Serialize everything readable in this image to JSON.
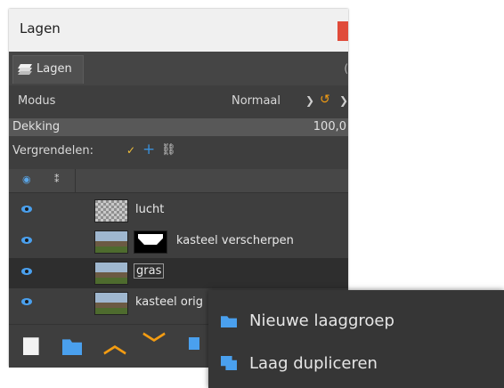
{
  "window": {
    "title": "Lagen"
  },
  "tab": {
    "label": "Lagen"
  },
  "mode": {
    "label": "Modus",
    "value": "Normaal"
  },
  "opacity": {
    "label": "Dekking",
    "value": "100,0"
  },
  "lock": {
    "label": "Vergrendelen:"
  },
  "layers": [
    {
      "name": "lucht",
      "selected": false
    },
    {
      "name": "kasteel verscherpen",
      "selected": false
    },
    {
      "name": "gras",
      "selected": true
    },
    {
      "name": "kasteel orig",
      "selected": false
    }
  ],
  "context_menu": {
    "items": [
      {
        "label": "Nieuwe laaggroep",
        "icon": "new-layer-group-icon"
      },
      {
        "label": "Laag dupliceren",
        "icon": "duplicate-layer-icon"
      }
    ]
  },
  "colors": {
    "accent": "#4aa0ee",
    "arrow": "#f39c12",
    "panel": "#3e3e3e"
  }
}
